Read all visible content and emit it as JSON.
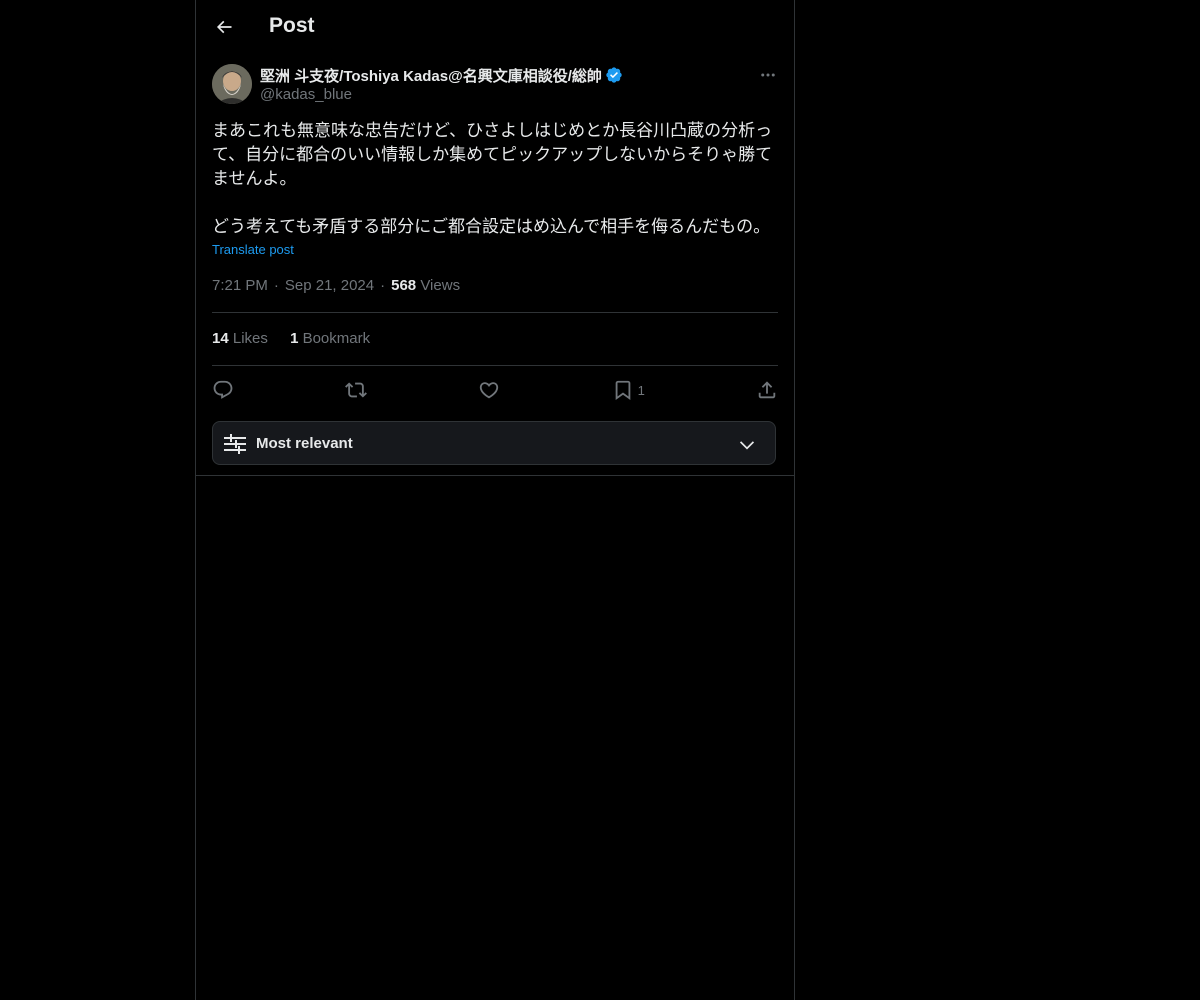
{
  "header": {
    "back_icon": "arrow-left-icon",
    "title": "Post"
  },
  "author": {
    "name": "堅洲 斗支夜/Toshiya Kadas@名興文庫相談役/総帥",
    "handle": "@kadas_blue",
    "verified": true,
    "verified_color": "#1d9bf0"
  },
  "post": {
    "paragraphs": [
      "まあこれも無意味な忠告だけど、ひさよしはじめとか長谷川凸蔵の分析って、自分に都合のいい情報しか集めてピックアップしないからそりゃ勝てませんよ。",
      "どう考えても矛盾する部分にご都合設定はめ込んで相手を侮るんだもの。"
    ],
    "translate_label": "Translate post",
    "time": "7:21 PM",
    "date": "Sep 21, 2024",
    "views_count": "568",
    "views_label": "Views"
  },
  "stats": {
    "likes_count": "14",
    "likes_label": "Likes",
    "bookmarks_count": "1",
    "bookmarks_label": "Bookmark"
  },
  "actions": {
    "reply_icon": "reply-icon",
    "repost_icon": "repost-icon",
    "like_icon": "heart-icon",
    "bookmark_icon": "bookmark-icon",
    "bookmark_count": "1",
    "share_icon": "share-icon"
  },
  "sort": {
    "label": "Most relevant",
    "icon": "sliders-icon",
    "chevron": "chevron-down-icon"
  },
  "colors": {
    "background": "#000000",
    "text": "#e7e9ea",
    "secondary": "#71767b",
    "border": "#2f3336",
    "accent": "#1d9bf0"
  }
}
